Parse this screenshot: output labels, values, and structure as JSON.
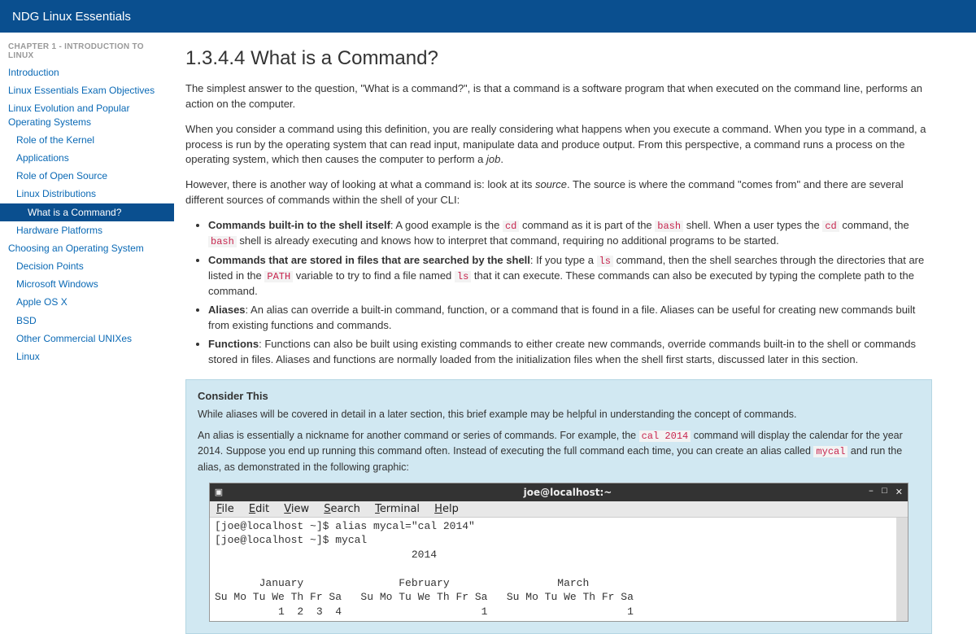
{
  "header": {
    "title": "NDG Linux Essentials"
  },
  "sidebar": {
    "chapter_label": "CHAPTER 1 - INTRODUCTION TO LINUX",
    "items": [
      {
        "label": "Introduction",
        "indent": 0,
        "active": false
      },
      {
        "label": "Linux Essentials Exam Objectives",
        "indent": 0,
        "active": false
      },
      {
        "label": "Linux Evolution and Popular Operating Systems",
        "indent": 0,
        "active": false
      },
      {
        "label": "Role of the Kernel",
        "indent": 1,
        "active": false
      },
      {
        "label": "Applications",
        "indent": 1,
        "active": false
      },
      {
        "label": "Role of Open Source",
        "indent": 1,
        "active": false
      },
      {
        "label": "Linux Distributions",
        "indent": 1,
        "active": false
      },
      {
        "label": "What is a Command?",
        "indent": 2,
        "active": true
      },
      {
        "label": "Hardware Platforms",
        "indent": 1,
        "active": false
      },
      {
        "label": "Choosing an Operating System",
        "indent": 0,
        "active": false
      },
      {
        "label": "Decision Points",
        "indent": 1,
        "active": false
      },
      {
        "label": "Microsoft Windows",
        "indent": 1,
        "active": false
      },
      {
        "label": "Apple OS X",
        "indent": 1,
        "active": false
      },
      {
        "label": "BSD",
        "indent": 1,
        "active": false
      },
      {
        "label": "Other Commercial UNIXes",
        "indent": 1,
        "active": false
      },
      {
        "label": "Linux",
        "indent": 1,
        "active": false
      }
    ]
  },
  "article": {
    "title": "1.3.4.4 What is a Command?",
    "p1": "The simplest answer to the question, \"What is a command?\", is that a command is a software program that when executed on the command line, performs an action on the computer.",
    "p2_a": "When you consider a command using this definition, you are really considering what happens when you execute a command. When you type in a command, a process is run by the operating system that can read input, manipulate data and produce output. From this perspective, a command runs a process on the operating system, which then causes the computer to perform a ",
    "p2_em": "job",
    "p2_b": ".",
    "p3_a": "However, there is another way of looking at what a command is: look at its ",
    "p3_em": "source",
    "p3_b": ". The source is where the command \"comes from\" and there are several different sources of commands within the shell of your CLI:",
    "li1_strong": "Commands built-in to the shell itself",
    "li1_a": ": A good example is the ",
    "li1_code1": "cd",
    "li1_b": " command as it is part of the ",
    "li1_code2": "bash",
    "li1_c": " shell. When a user types the ",
    "li1_code3": "cd",
    "li1_d": " command, the ",
    "li1_code4": "bash",
    "li1_e": " shell is already executing and knows how to interpret that command, requiring no additional programs to be started.",
    "li2_strong": "Commands that are stored in files that are searched by the shell",
    "li2_a": ": If you type a ",
    "li2_code1": "ls",
    "li2_b": " command, then the shell searches through the directories that are listed in the ",
    "li2_code2": "PATH",
    "li2_c": " variable to try to find a file named ",
    "li2_code3": "ls",
    "li2_d": " that it can execute. These commands can also be executed by typing the complete path to the command.",
    "li3_strong": "Aliases",
    "li3_a": ": An alias can override a built-in command, function, or a command that is found in a file. Aliases can be useful for creating new commands built from existing functions and commands.",
    "li4_strong": "Functions",
    "li4_a": ": Functions can also be built using existing commands to either create new commands, override commands built-in to the shell or commands stored in files. Aliases and functions are normally loaded from the initialization files when the shell first starts, discussed later in this section."
  },
  "callout": {
    "title": "Consider This",
    "p1": "While aliases will be covered in detail in a later section, this brief example may be helpful in understanding the concept of commands.",
    "p2_a": "An alias is essentially a nickname for another command or series of commands. For example, the ",
    "p2_code1": "cal 2014",
    "p2_b": " command will display the calendar for the year 2014. Suppose you end up running this command often. Instead of executing the full command each time, you can create an alias called ",
    "p2_code2": "mycal",
    "p2_c": " and run the alias, as demonstrated in the following graphic:"
  },
  "terminal": {
    "window_title": "joe@localhost:~",
    "menu": {
      "file": "File",
      "edit": "Edit",
      "view": "View",
      "search": "Search",
      "terminal": "Terminal",
      "help": "Help"
    },
    "body": "[joe@localhost ~]$ alias mycal=\"cal 2014\"\n[joe@localhost ~]$ mycal\n                               2014\n\n       January               February                 March\nSu Mo Tu We Th Fr Sa   Su Mo Tu We Th Fr Sa   Su Mo Tu We Th Fr Sa\n          1  2  3  4                      1                      1"
  }
}
